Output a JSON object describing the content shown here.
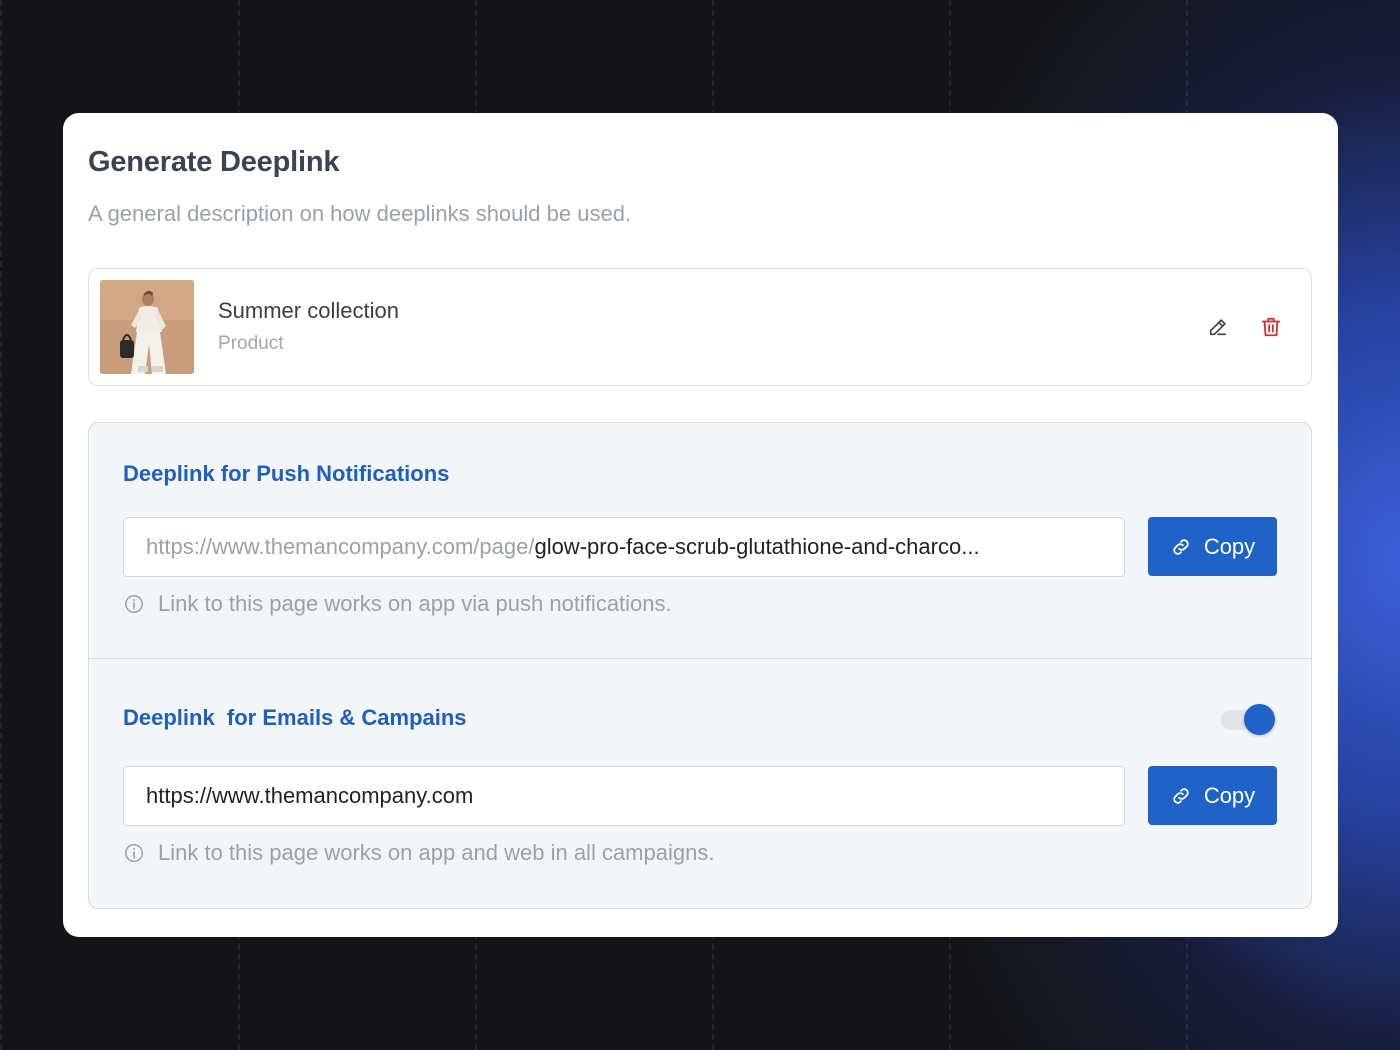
{
  "card": {
    "title": "Generate Deeplink",
    "subtitle": "A general description on how deeplinks should be used."
  },
  "product": {
    "name": "Summer collection",
    "type": "Product",
    "thumbnail": "fashion-model-photo",
    "actions": {
      "edit_icon": "pencil-icon",
      "delete_icon": "trash-icon",
      "delete_color": "#d32f2f"
    }
  },
  "push_section": {
    "title": "Deeplink for Push Notifications",
    "url_prefix": "https://www.themancompany.com/page/",
    "url_path": "glow-pro-face-scrub-glutathione-and-charco...",
    "copy_label": "Copy",
    "hint": "Link to this page works on app via push notifications."
  },
  "email_section": {
    "title": "Deeplink  for Emails & Campains",
    "toggle_on": true,
    "url": "https://www.themancompany.com",
    "copy_label": "Copy",
    "hint": "Link to this page works on app and web in all campaigns."
  },
  "colors": {
    "accent": "#1f63c9",
    "section_title": "#1f5fbf",
    "muted_text": "#9aa1ab",
    "danger": "#d32f2f"
  }
}
